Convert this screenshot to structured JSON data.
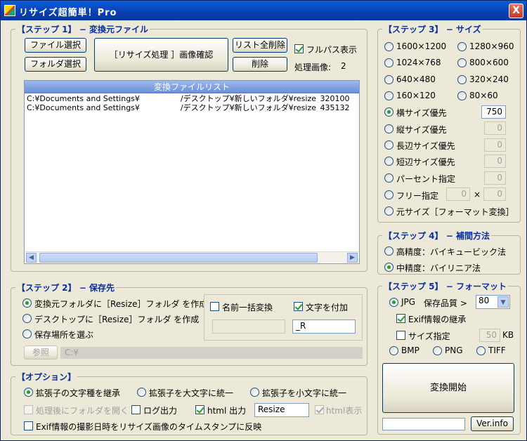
{
  "window": {
    "title": "リサイズ超簡単！Pro",
    "close_label": "X"
  },
  "step1": {
    "title": "【ステップ 1】 − 変換元ファイル",
    "file_select_button": "ファイル選択",
    "folder_select_button": "フォルダ選択",
    "confirm_button": "［リサイズ処理 ］画像確認",
    "clear_list_button": "リスト全削除",
    "delete_button": "削除",
    "fullpath_label": "フルパス表示",
    "fullpath_checked": true,
    "processed_label": "処理画像:",
    "processed_count": "2",
    "list_header": "変換ファイルリスト",
    "files": [
      {
        "prefix": "C:¥Documents and Settings¥",
        "suffix": "/デスクトップ¥新しいフォルダ¥resize_320100"
      },
      {
        "prefix": "C:¥Documents and Settings¥",
        "suffix": "/デスクトップ¥新しいフォルダ¥resize_435132"
      }
    ]
  },
  "step2": {
    "title": "【ステップ 2】 − 保存先",
    "options": [
      {
        "label": "変換元フォルダに［Resize］フォルダ を作成",
        "checked": true
      },
      {
        "label": "デスクトップに［Resize］フォルダ を作成",
        "checked": false
      },
      {
        "label": "保存場所を選ぶ",
        "checked": false
      }
    ],
    "rename_label": "名前一括変換",
    "rename_checked": false,
    "rename_value": "",
    "append_label": "文字を付加",
    "append_checked": true,
    "append_value": "_R",
    "browse_button": "参照",
    "save_path": "C:¥"
  },
  "options": {
    "title": "【オプション】",
    "ext_options": [
      {
        "label": "拡張子の文字種を継承",
        "checked": true
      },
      {
        "label": "拡張子を大文字に統一",
        "checked": false
      },
      {
        "label": "拡張子を小文字に統一",
        "checked": false
      }
    ],
    "open_folder_label": "処理後にフォルダを開く",
    "log_label": "ログ出力",
    "html_label": "html 出力",
    "html_value": "Resize",
    "html_view_label": "html表示",
    "exif_timestamp_label": "Exif情報の撮影日時をリサイズ画像のタイムスタンプに反映"
  },
  "step3": {
    "title": "【ステップ 3】 − サイズ",
    "presets": [
      {
        "label": "1600×1200",
        "checked": false
      },
      {
        "label": "1280×960",
        "checked": false
      },
      {
        "label": "1024×768",
        "checked": false
      },
      {
        "label": "800×600",
        "checked": false
      },
      {
        "label": "640×480",
        "checked": false
      },
      {
        "label": "320×240",
        "checked": false
      },
      {
        "label": "160×120",
        "checked": false
      },
      {
        "label": "80×60",
        "checked": false
      }
    ],
    "width_priority_label": "横サイズ優先",
    "width_priority_value": "750",
    "height_priority_label": "縦サイズ優先",
    "height_priority_value": "0",
    "long_side_label": "長辺サイズ優先",
    "long_side_value": "0",
    "short_side_label": "短辺サイズ優先",
    "short_side_value": "0",
    "percent_label": "パーセント指定",
    "percent_value": "0",
    "free_label": "フリー指定",
    "free_width": "0",
    "free_times": "×",
    "free_height": "0",
    "original_label": "元サイズ［フォーマット変換］"
  },
  "step4": {
    "title": "【ステップ 4】 − 補間方法",
    "options": [
      {
        "label": "高精度：バイキュービック法",
        "checked": false
      },
      {
        "label": "中精度：バイリニア法",
        "checked": true
      }
    ]
  },
  "step5": {
    "title": "【ステップ 5】 − フォーマット",
    "jpg_label": "JPG",
    "quality_label": "保存品質 >",
    "quality_value": "80",
    "exif_inherit_label": "Exif情報の継承",
    "size_spec_label": "サイズ指定",
    "size_spec_value": "50",
    "size_unit": "KB",
    "bmp_label": "BMP",
    "png_label": "PNG",
    "tiff_label": "TIFF",
    "start_button": "変換開始",
    "ver_button": "Ver.info"
  }
}
